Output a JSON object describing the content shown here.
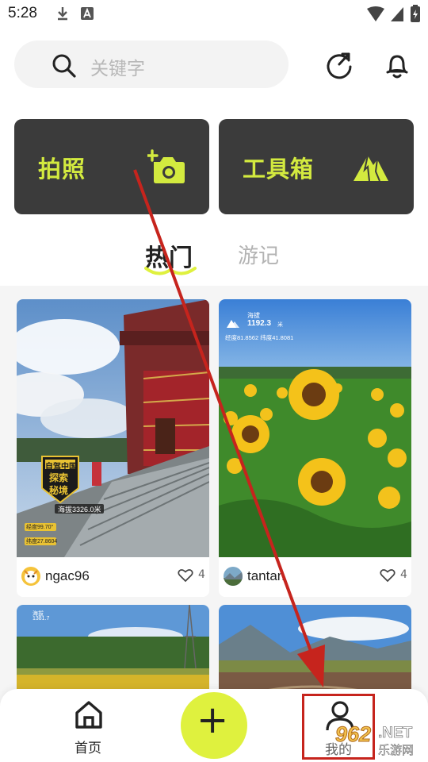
{
  "status_bar": {
    "time": "5:28"
  },
  "search": {
    "placeholder": "关键字"
  },
  "features": [
    {
      "label": "拍照",
      "icon": "camera-add-icon"
    },
    {
      "label": "工具箱",
      "icon": "mountain-icon"
    }
  ],
  "tabs": [
    {
      "label": "热门",
      "active": true
    },
    {
      "label": "游记",
      "active": false
    }
  ],
  "posts": [
    {
      "user": "ngac96",
      "likes": "4",
      "overlay": {
        "badge_line1": "自驾中国",
        "badge_line2": "探索",
        "badge_line3": "秘境",
        "altitude": "海拔3326.0米",
        "lon": "经度99.70°",
        "lat": "纬度27.8604"
      }
    },
    {
      "user": "tantan",
      "likes": "4",
      "overlay": {
        "alt_label": "海拔",
        "alt_value": "1192.3",
        "alt_unit": "米",
        "coords": "经度81.8562  纬度41.8081"
      }
    },
    {
      "overlay": {
        "alt_label": "海拔",
        "alt_value": "1381.7"
      }
    },
    {
      "overlay": {}
    }
  ],
  "bottom_nav": {
    "home_label": "首页",
    "mine_label": "我的"
  },
  "watermark": {
    "number": "962",
    "net": ".NET",
    "sub": "乐游网"
  },
  "colors": {
    "accent": "#dff13e",
    "card_bg": "#3b3b3b",
    "annotation": "#c6241d"
  }
}
